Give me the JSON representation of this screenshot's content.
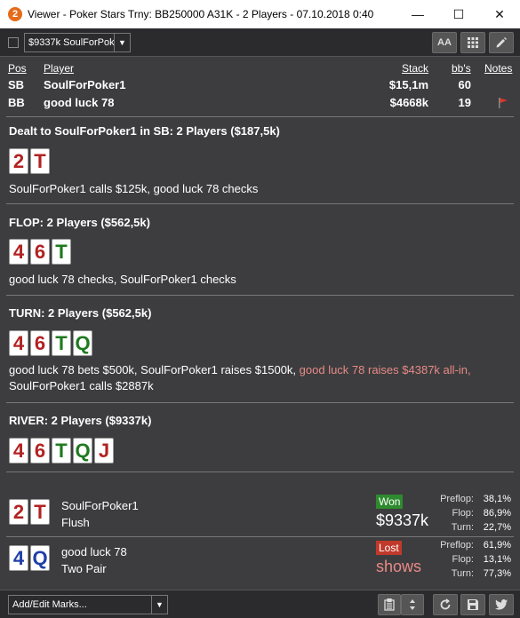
{
  "window": {
    "title": "Viewer - Poker Stars Trny: BB250000 A31K - 2 Players - 07.10.2018 0:40",
    "app_icon": "2",
    "controls": {
      "minimize": "—",
      "maximize": "☐",
      "close": "✕"
    }
  },
  "toolbar": {
    "hand_select_value": "$9337k SoulForPoke",
    "font_button": "AA",
    "grid_icon": "grid-icon",
    "edit_icon": "pencil-icon"
  },
  "players_table": {
    "headers": {
      "pos": "Pos",
      "player": "Player",
      "stack": "Stack",
      "bbs": "bb's",
      "notes": "Notes"
    },
    "rows": [
      {
        "pos": "SB",
        "player": "SoulForPoker1",
        "stack": "$15,1m",
        "bbs": "60",
        "note_flag": false
      },
      {
        "pos": "BB",
        "player": "good luck 78",
        "stack": "$4668k",
        "bbs": "19",
        "note_flag": true
      }
    ]
  },
  "streets": {
    "preflop": {
      "title": "Dealt to SoulForPoker1 in SB: 2 Players ($187,5k)",
      "cards": [
        {
          "rank": "2",
          "color": "#b22222"
        },
        {
          "rank": "T",
          "color": "#b22222"
        }
      ],
      "action": "SoulForPoker1 calls $125k, good luck 78 checks"
    },
    "flop": {
      "title": "FLOP: 2 Players ($562,5k)",
      "cards": [
        {
          "rank": "4",
          "color": "#b22222"
        },
        {
          "rank": "6",
          "color": "#b22222"
        },
        {
          "rank": "T",
          "color": "#1e7a1e"
        }
      ],
      "action": "good luck 78 checks, SoulForPoker1 checks"
    },
    "turn": {
      "title": "TURN: 2 Players ($562,5k)",
      "cards": [
        {
          "rank": "4",
          "color": "#b22222"
        },
        {
          "rank": "6",
          "color": "#b22222"
        },
        {
          "rank": "T",
          "color": "#1e7a1e"
        },
        {
          "rank": "Q",
          "color": "#1e7a1e"
        }
      ],
      "action_plain": "good luck 78 bets $500k, SoulForPoker1 raises $1500k, ",
      "action_highlight": "good luck 78 raises $4387k all-in,",
      "action_line2": "SoulForPoker1 calls $2887k"
    },
    "river": {
      "title": "RIVER: 2 Players ($9337k)",
      "cards": [
        {
          "rank": "4",
          "color": "#b22222"
        },
        {
          "rank": "6",
          "color": "#b22222"
        },
        {
          "rank": "T",
          "color": "#1e7a1e"
        },
        {
          "rank": "Q",
          "color": "#1e7a1e"
        },
        {
          "rank": "J",
          "color": "#b22222"
        }
      ]
    }
  },
  "results": [
    {
      "cards": [
        {
          "rank": "2",
          "color": "#b22222"
        },
        {
          "rank": "T",
          "color": "#b22222"
        }
      ],
      "name": "SoulForPoker1",
      "hand": "Flush",
      "badge": "Won",
      "badge_color": "#2e8b2e",
      "amount": "$9337k",
      "amount_color": "#ffffff",
      "stats": [
        {
          "label": "Preflop:",
          "value": "38,1%"
        },
        {
          "label": "Flop:",
          "value": "86,9%"
        },
        {
          "label": "Turn:",
          "value": "22,7%"
        }
      ]
    },
    {
      "cards": [
        {
          "rank": "4",
          "color": "#1f3fa8"
        },
        {
          "rank": "Q",
          "color": "#1f3fa8"
        }
      ],
      "name": "good luck 78",
      "hand": "Two Pair",
      "badge": "Lost",
      "badge_color": "#c0392b",
      "amount": "shows",
      "amount_color": "#e78a86",
      "stats": [
        {
          "label": "Preflop:",
          "value": "61,9%"
        },
        {
          "label": "Flop:",
          "value": "13,1%"
        },
        {
          "label": "Turn:",
          "value": "77,3%"
        }
      ]
    }
  ],
  "bottombar": {
    "marks_placeholder": "Add/Edit Marks...",
    "icons": [
      "clipboard-icon",
      "updown-icon",
      "refresh-icon",
      "save-icon",
      "twitter-icon"
    ]
  }
}
